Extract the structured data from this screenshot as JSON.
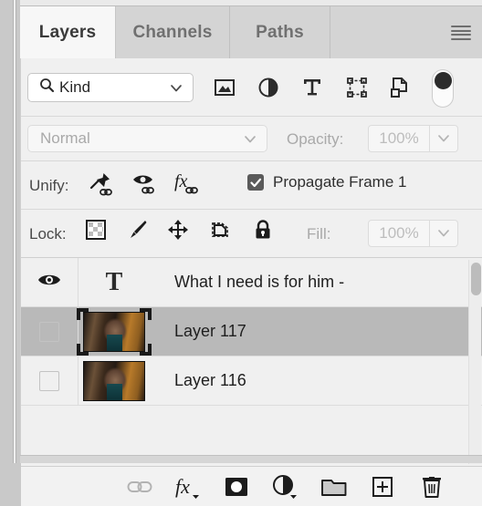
{
  "panel": {
    "title": "Layers",
    "tabs": [
      {
        "label": "Layers",
        "active": true
      },
      {
        "label": "Channels",
        "active": false
      },
      {
        "label": "Paths",
        "active": false
      }
    ],
    "menu_icon": "hamburger-menu-icon"
  },
  "filter_row": {
    "kind_label": "Kind",
    "search_icon": "search-icon",
    "chevron_icon": "chevron-down-icon",
    "filter_icons": [
      {
        "name": "pixel-layer-filter-icon",
        "tooltip": "Filter for pixel layers"
      },
      {
        "name": "adjustment-layer-filter-icon",
        "tooltip": "Filter for adjustment layers"
      },
      {
        "name": "type-layer-filter-icon",
        "tooltip": "Filter for type layers"
      },
      {
        "name": "shape-layer-filter-icon",
        "tooltip": "Filter for shape layers"
      },
      {
        "name": "smart-object-filter-icon",
        "tooltip": "Filter for smart objects"
      }
    ],
    "toggle_state": "on"
  },
  "blend_row": {
    "blend_mode": "Normal",
    "opacity_label": "Opacity:",
    "opacity_value": "100%",
    "disabled": true
  },
  "unify_row": {
    "label": "Unify:",
    "icons": [
      {
        "name": "unify-position-pin-icon"
      },
      {
        "name": "unify-visibility-eye-icon"
      },
      {
        "name": "unify-style-fx-icon"
      }
    ],
    "propagate_label": "Propagate Frame 1",
    "propagate_checked": true
  },
  "lock_row": {
    "label": "Lock:",
    "icons": [
      {
        "name": "lock-transparent-pixels-icon"
      },
      {
        "name": "lock-image-pixels-brush-icon"
      },
      {
        "name": "lock-position-move-icon"
      },
      {
        "name": "lock-artboard-nesting-icon"
      },
      {
        "name": "lock-all-padlock-icon"
      }
    ],
    "fill_label": "Fill:",
    "fill_value": "100%"
  },
  "layers": [
    {
      "name": "What I need is for him -",
      "type": "text",
      "visible": true,
      "selected": false,
      "thumbnail": "T"
    },
    {
      "name": "Layer 117",
      "type": "image",
      "visible": false,
      "selected": true,
      "thumbnail": "photo"
    },
    {
      "name": "Layer 116",
      "type": "image",
      "visible": false,
      "selected": false,
      "thumbnail": "photo"
    }
  ],
  "bottom_toolbar": [
    {
      "name": "link-layers-button",
      "icon": "link-icon",
      "disabled": true
    },
    {
      "name": "layer-style-button",
      "icon": "fx-icon",
      "disabled": false
    },
    {
      "name": "add-layer-mask-button",
      "icon": "mask-icon",
      "disabled": false
    },
    {
      "name": "new-adjustment-layer-button",
      "icon": "adjustment-circle-icon",
      "disabled": false
    },
    {
      "name": "new-group-button",
      "icon": "folder-icon",
      "disabled": false
    },
    {
      "name": "new-layer-button",
      "icon": "plus-square-icon",
      "disabled": false
    },
    {
      "name": "delete-layer-button",
      "icon": "trash-icon",
      "disabled": false
    }
  ],
  "colors": {
    "panel_bg": "#f0f0f0",
    "tab_inactive": "#d4d4d4",
    "tab_active": "#f7f7f7",
    "selected_row": "#b9b9b9",
    "text_primary": "#1f1f1f",
    "text_disabled": "#a9a9a9",
    "checkbox_fill": "#5a5a5a"
  }
}
